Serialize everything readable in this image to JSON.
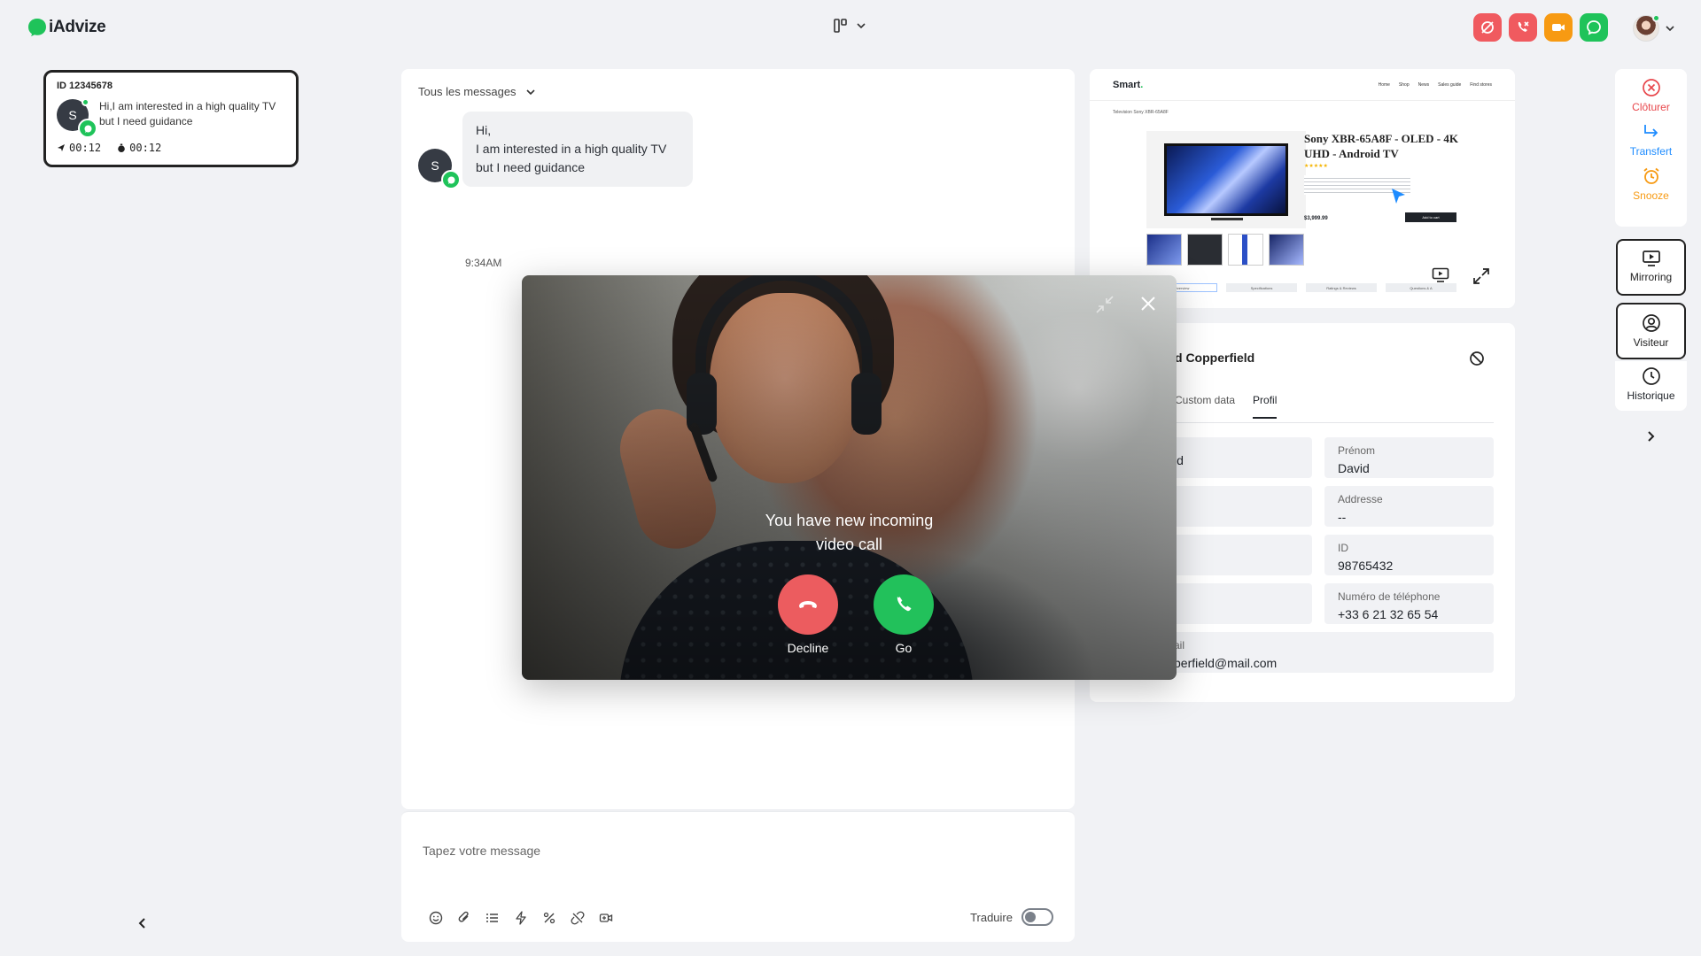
{
  "app": {
    "name": "iAdvize"
  },
  "colors": {
    "accent_green": "#1fc35a",
    "danger_red": "#ec5c5f",
    "warning_orange": "#f79a12",
    "dark": "#1f2329"
  },
  "header": {
    "layout_icon": "layout-columns-icon",
    "actions": [
      {
        "icon": "chat-off-icon",
        "color": "#f05a5f"
      },
      {
        "icon": "phone-off-icon",
        "color": "#f05a5f"
      },
      {
        "icon": "video-camera-icon",
        "color": "#f79a12"
      },
      {
        "icon": "chat-bubble-icon",
        "color": "#1fc35a"
      }
    ]
  },
  "conversation_card": {
    "id_label": "ID 12345678",
    "avatar_initial": "S",
    "preview": "Hi,I am interested in a high quality TV but I need guidance",
    "timer_sent": "00:12",
    "timer_elapsed": "00:12"
  },
  "chat": {
    "filter_label": "Tous les messages",
    "message": {
      "avatar_initial": "S",
      "line1": "Hi,",
      "line2": "I am interested in a high quality TV but I need guidance",
      "time": "9:34AM"
    },
    "composer": {
      "placeholder": "Tapez votre message",
      "translate_label": "Traduire",
      "tools": [
        "emoji-icon",
        "attachment-icon",
        "list-icon",
        "lightning-icon",
        "percent-icon",
        "link-off-icon",
        "video-icon"
      ]
    }
  },
  "preview": {
    "brand": "Smart",
    "nav": [
      "Home",
      "Shop",
      "News",
      "Sales guide",
      "Find stores"
    ],
    "breadcrumb": "Television  Sony XBR-65A8F",
    "product_title": "Sony XBR-65A8F - OLED - 4K UHD - Android TV",
    "rating": "★★★★★",
    "price": "$3,999.99",
    "cart_label": "Add to cart",
    "tabs": [
      "Overview",
      "Specifications",
      "Ratings & Reviews",
      "Questions & A"
    ]
  },
  "visitor": {
    "name": "d Copperfield",
    "tabs": [
      "Custom data",
      "Profil"
    ],
    "fields": {
      "left_1": {
        "label": "",
        "value": "ld"
      },
      "prenom": {
        "label": "Prénom",
        "value": "David"
      },
      "adresse": {
        "label": "Addresse",
        "value": "--"
      },
      "id": {
        "label": "ID",
        "value": "98765432"
      },
      "phone": {
        "label": "Numéro de téléphone",
        "value": "+33 6 21 32 65 54"
      },
      "email": {
        "label": "ail",
        "value": "perfield@mail.com"
      }
    }
  },
  "rail": {
    "cloturer": "Clôturer",
    "transfert": "Transfert",
    "snooze": "Snooze",
    "mirroring": "Mirroring",
    "visiteur": "Visiteur",
    "historique": "Historique"
  },
  "video_call": {
    "title_line1": "You have new incoming",
    "title_line2": "video call",
    "decline_label": "Decline",
    "go_label": "Go"
  }
}
